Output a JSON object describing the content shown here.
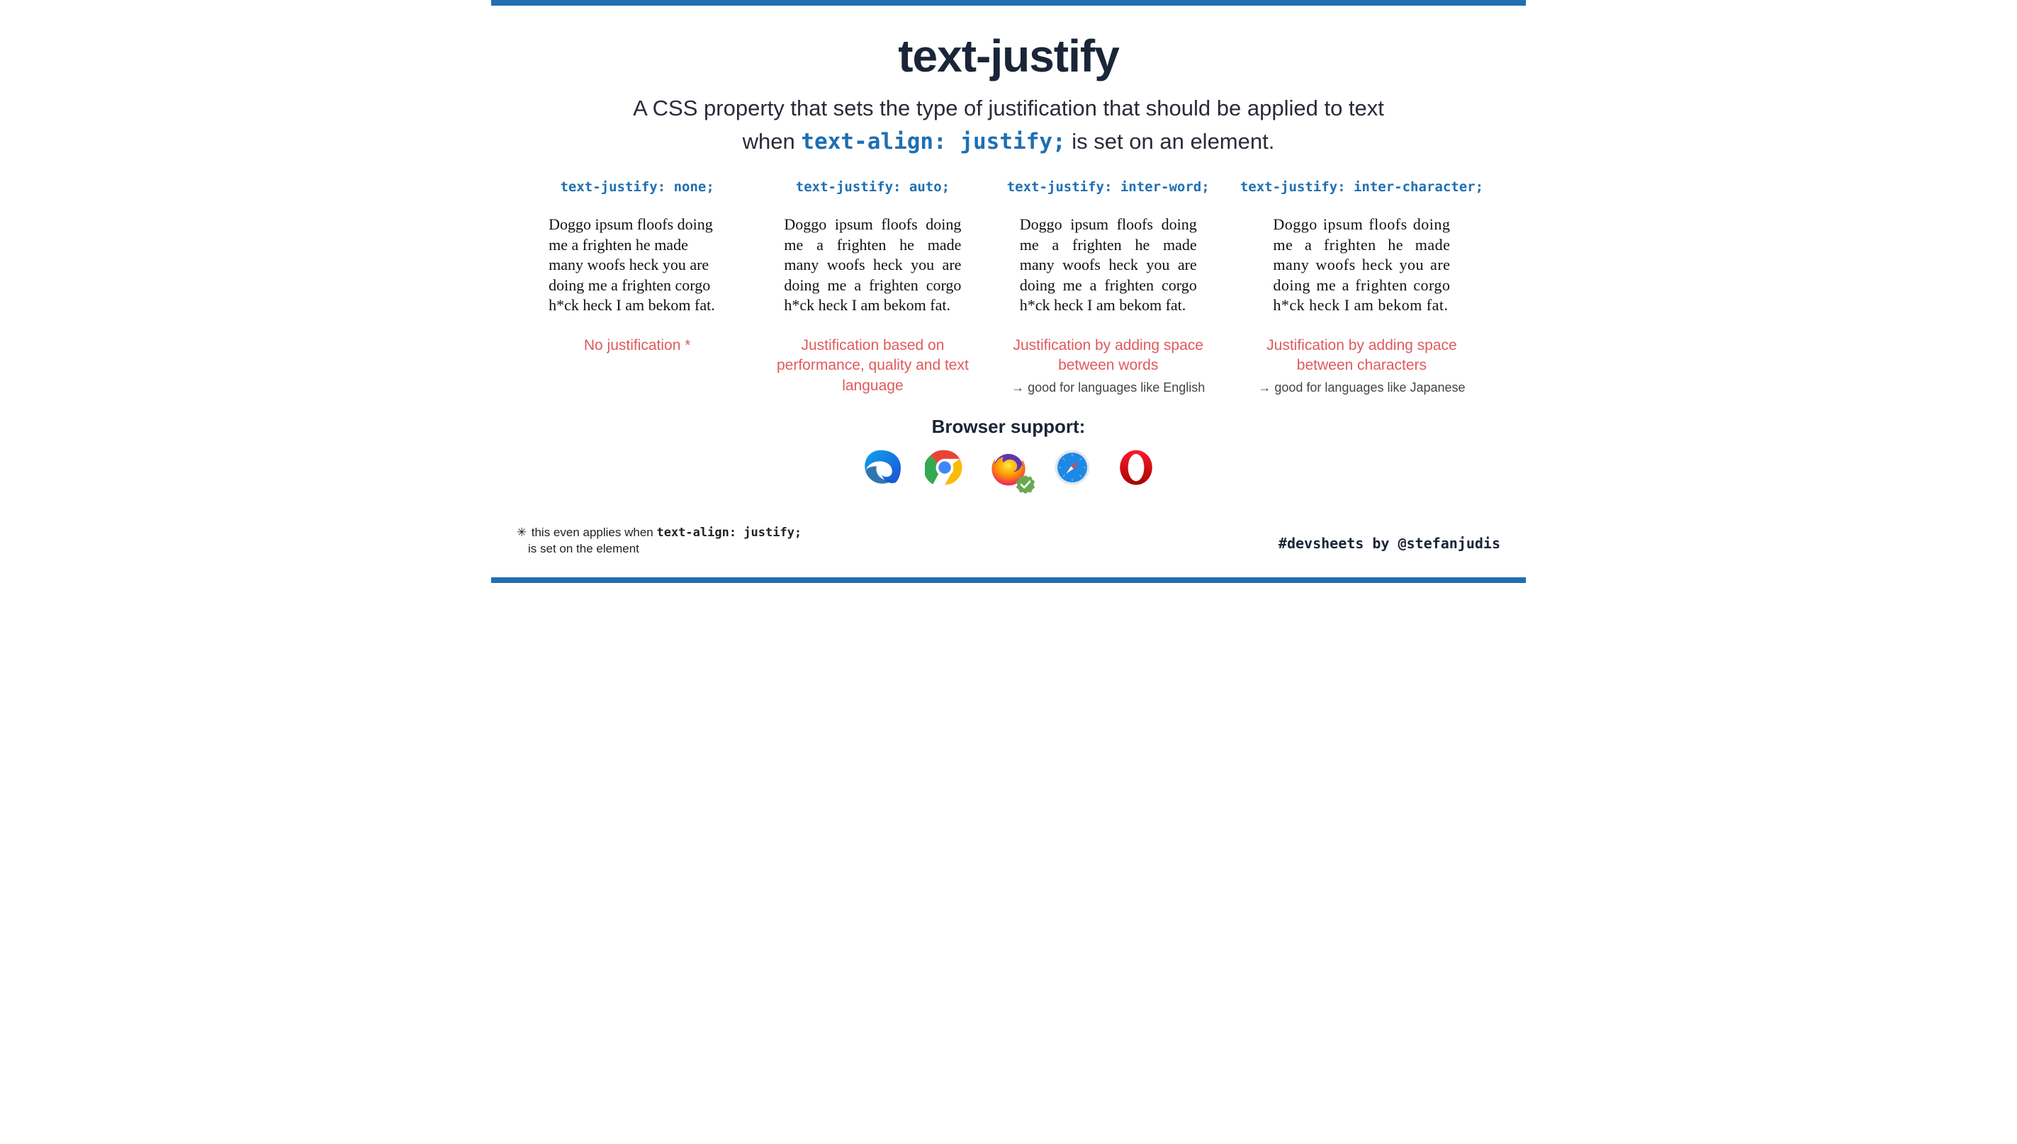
{
  "title": "text-justify",
  "subtitle_lead": "A CSS property that sets the type of justification that should be applied to text",
  "subtitle_when": "when ",
  "subtitle_code": "text-align: justify;",
  "subtitle_tail": " is set on an element.",
  "sample_text": "Doggo ipsum floofs doing me a frighten he made many woofs heck you are doing me a frighten corgo h*ck heck I am bekom fat.",
  "columns": [
    {
      "head": "text-justify: none;",
      "caption": "No justification *",
      "note": ""
    },
    {
      "head": "text-justify: auto;",
      "caption": "Justification based on performance, quality and text language",
      "note": ""
    },
    {
      "head": "text-justify: inter-word;",
      "caption": "Justification by adding space between words",
      "note": "→ good for languages like English"
    },
    {
      "head": "text-justify: inter-character;",
      "caption": "Justification by adding space between characters",
      "note": "→ good for languages like Japanese"
    }
  ],
  "support_label": "Browser support:",
  "footnote_star": "✳",
  "footnote_lead": "this even applies when ",
  "footnote_code": "text-align: justify;",
  "footnote_tail": "is set on the element",
  "credit": "#devsheets by @stefanjudis"
}
